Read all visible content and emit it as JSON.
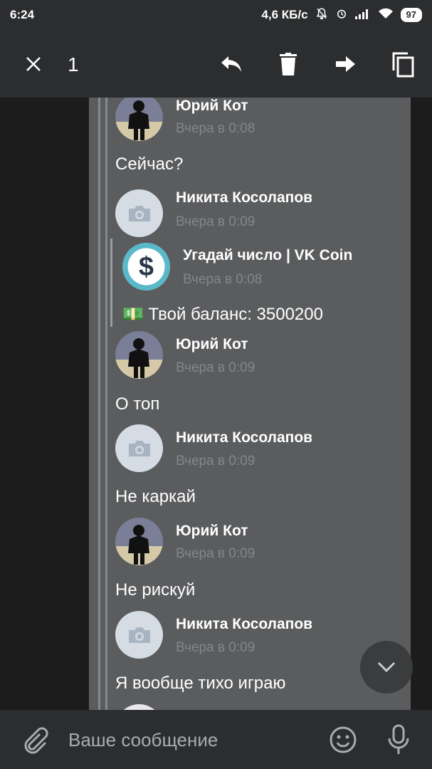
{
  "status_bar": {
    "time": "6:24",
    "network_speed": "4,6 КБ/с",
    "battery": "97"
  },
  "action_bar": {
    "selected_count": "1"
  },
  "messages": [
    {
      "name": "Юрий Кот",
      "time": "Вчера в 0:08",
      "text": "Сейчас?"
    },
    {
      "name": "Никита Косолапов",
      "time": "Вчера в 0:09",
      "text": ""
    },
    {
      "name": "Угадай число | VK Coin",
      "time": "Вчера в 0:08",
      "text": "💵 Твой баланс: 3500200"
    },
    {
      "name": "Юрий Кот",
      "time": "Вчера в 0:09",
      "text": "О топ"
    },
    {
      "name": "Никита Косолапов",
      "time": "Вчера в 0:09",
      "text": "Не каркай"
    },
    {
      "name": "Юрий Кот",
      "time": "Вчера в 0:09",
      "text": "Не рискуй"
    },
    {
      "name": "Никита Косолапов",
      "time": "Вчера в 0:09",
      "text": "Я вообще тихо играю"
    }
  ],
  "composer": {
    "placeholder": "Ваше сообщение"
  }
}
